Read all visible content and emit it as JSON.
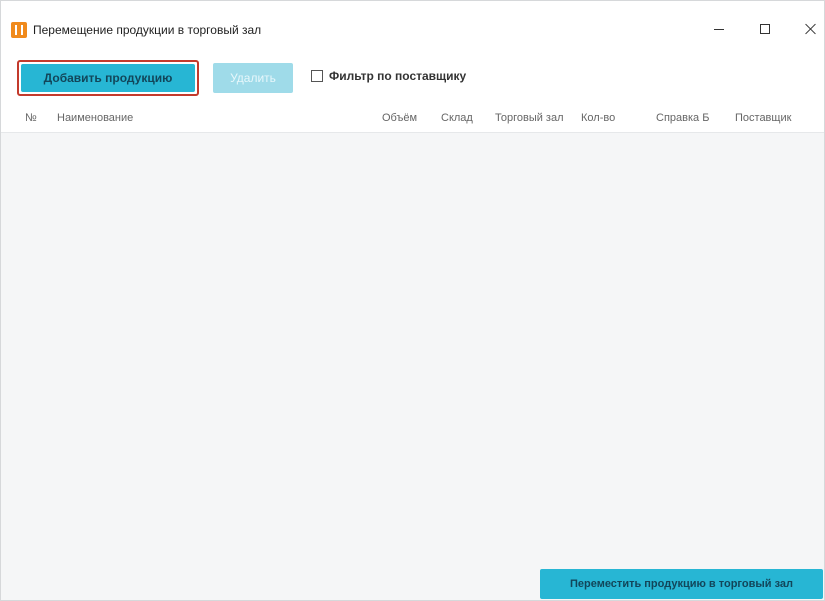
{
  "window": {
    "title": "Перемещение продукции в торговый зал",
    "icon": "app-icon",
    "controls": {
      "minimize": "minimize-icon",
      "maximize": "maximize-icon",
      "close": "close-icon"
    }
  },
  "toolbar": {
    "add_label": "Добавить продукцию",
    "delete_label": "Удалить",
    "filter_label": "Фильтр по поставщику",
    "filter_checked": false,
    "accent_color": "#27b6d4",
    "highlight_color": "#c33a2c"
  },
  "table": {
    "columns": [
      "№",
      "Наименование",
      "Объём",
      "Склад",
      "Торговый зал",
      "Кол-во",
      "Справка Б",
      "Поставщик"
    ],
    "rows": []
  },
  "footer": {
    "move_label": "Переместить продукцию в торговый зал"
  }
}
